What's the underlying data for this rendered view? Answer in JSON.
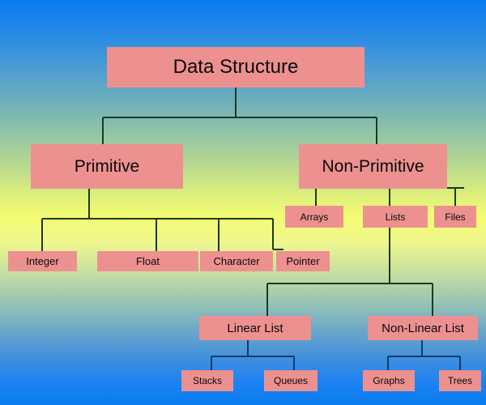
{
  "diagram": {
    "title": "Data Structure classification tree",
    "colors": {
      "node_fill": "#ec9190",
      "node_text": "#0a0a0a",
      "connector_dark": "#1d3a1d",
      "connector_blue": "#123a6b",
      "background_top": "#0a7cf0",
      "background_mid": "#f6fb72"
    },
    "nodes": {
      "root": "Data Structure",
      "primitive": "Primitive",
      "non_primitive": "Non-Primitive",
      "integer": "Integer",
      "float": "Float",
      "character": "Character",
      "pointer": "Pointer",
      "arrays": "Arrays",
      "lists": "Lists",
      "files": "Files",
      "linear_list": "Linear List",
      "non_linear_list": "Non-Linear List",
      "stacks": "Stacks",
      "queues": "Queues",
      "graphs": "Graphs",
      "trees": "Trees"
    }
  }
}
